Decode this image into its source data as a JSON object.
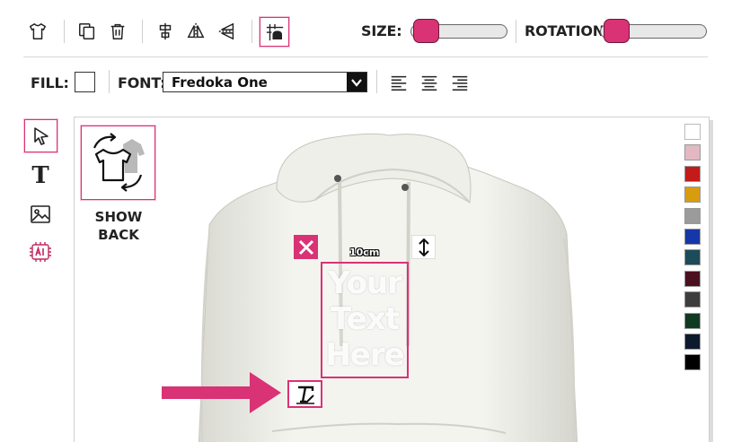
{
  "toolbar": {
    "size_label": "SIZE:",
    "rotation_label": "ROTATION:",
    "size_value": 0.05,
    "rotation_value": 0.05,
    "icons": [
      "tshirt-icon",
      "duplicate-icon",
      "trash-icon",
      "align-center-icon",
      "flip-horizontal-icon",
      "flip-vertical-icon",
      "center-on-garment-icon"
    ]
  },
  "format_bar": {
    "fill_label": "FILL:",
    "font_label": "FONT:",
    "font_value": "Fredoka One",
    "align_icons": [
      "align-left-icon",
      "align-center-text-icon",
      "align-right-icon"
    ]
  },
  "side_tools": [
    "select-tool-icon",
    "text-tool-icon",
    "image-tool-icon",
    "ai-tool-icon"
  ],
  "show_back": {
    "line1": "SHOW",
    "line2": "BACK"
  },
  "design": {
    "width_label": "10cm",
    "text_lines": [
      "Your",
      "Text",
      "Here"
    ]
  },
  "palette": [
    "#ffffff",
    "#e3b8c2",
    "#c41a1a",
    "#d89c0f",
    "#9b9b9b",
    "#1537a8",
    "#1c4b5a",
    "#4a1020",
    "#3d3d3d",
    "#0f3a22",
    "#0c1a2e",
    "#000000"
  ],
  "colors": {
    "accent": "#d93275",
    "garment": "#f2f2ee"
  }
}
